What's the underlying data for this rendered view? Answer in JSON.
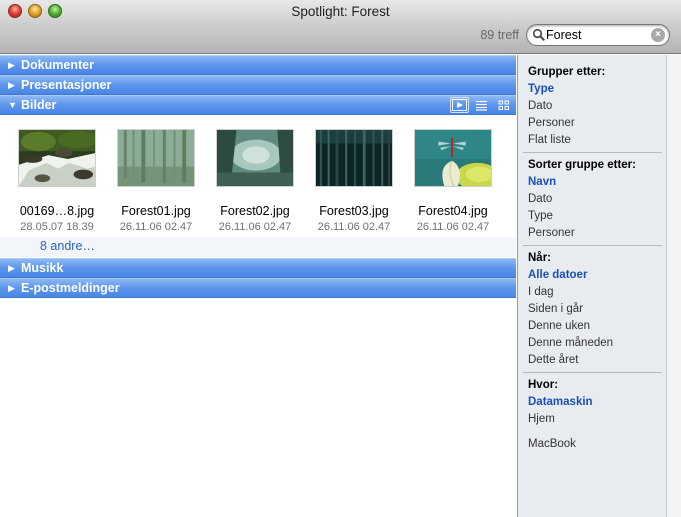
{
  "window": {
    "title": "Spotlight: Forest"
  },
  "toolbar": {
    "hits": "89 treff",
    "search_value": "Forest",
    "search_icon": "magnifier-icon",
    "clear_icon": "clear-icon"
  },
  "sections": {
    "documents": {
      "label": "Dokumenter"
    },
    "presentations": {
      "label": "Presentasjoner"
    },
    "images": {
      "label": "Bilder",
      "items": [
        {
          "name": "00169…8.jpg",
          "date": "28.05.07 18.39"
        },
        {
          "name": "Forest01.jpg",
          "date": "26.11.06 02.47"
        },
        {
          "name": "Forest02.jpg",
          "date": "26.11.06 02.47"
        },
        {
          "name": "Forest03.jpg",
          "date": "26.11.06 02.47"
        },
        {
          "name": "Forest04.jpg",
          "date": "26.11.06 02.47"
        }
      ],
      "more": "8 andre…"
    },
    "music": {
      "label": "Musikk"
    },
    "email": {
      "label": "E-postmeldinger"
    }
  },
  "sidebar": {
    "group_by": {
      "title": "Grupper etter:",
      "items": [
        "Type",
        "Dato",
        "Personer",
        "Flat liste"
      ],
      "active": "Type"
    },
    "sort_by": {
      "title": "Sorter gruppe etter:",
      "items": [
        "Navn",
        "Dato",
        "Type",
        "Personer"
      ],
      "active": "Navn"
    },
    "when": {
      "title": "Når:",
      "items": [
        "Alle datoer",
        "I dag",
        "Siden i går",
        "Denne uken",
        "Denne måneden",
        "Dette året"
      ],
      "active": "Alle datoer"
    },
    "where": {
      "title": "Hvor:",
      "items": [
        "Datamaskin",
        "Hjem"
      ],
      "active": "Datamaskin",
      "extra": "MacBook"
    }
  },
  "colors": {
    "section_header": "#5b95ec",
    "link": "#2a62c9",
    "active_item": "#1b4fb8"
  }
}
